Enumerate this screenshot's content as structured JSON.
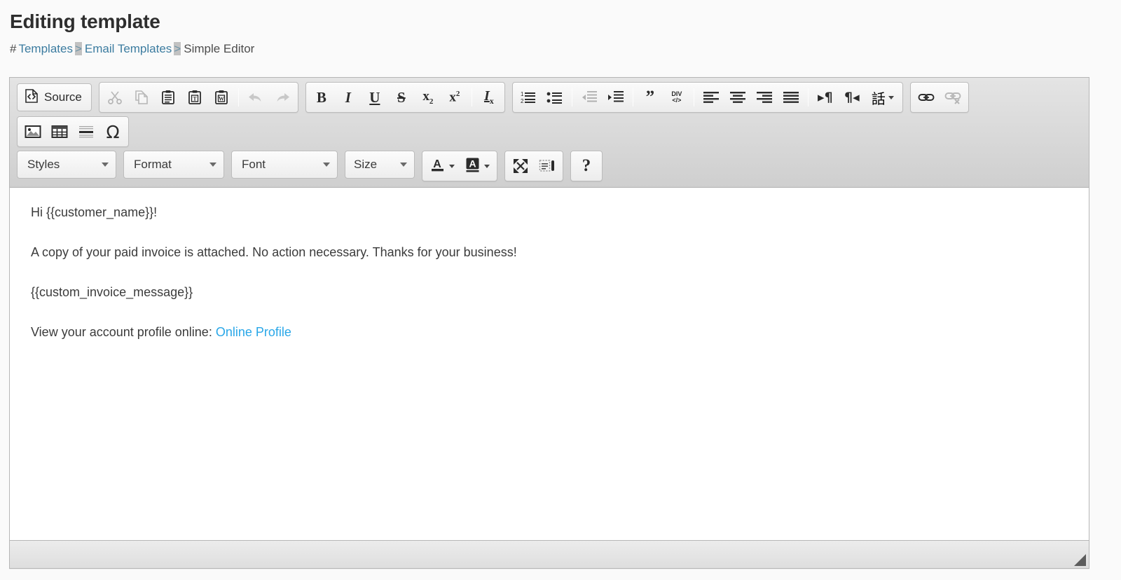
{
  "header": {
    "title": "Editing template",
    "breadcrumb": {
      "hash": "#",
      "items": [
        {
          "label": "Templates",
          "link": true
        },
        {
          "label": "Email Templates",
          "link": true
        },
        {
          "label": "Simple Editor",
          "link": false
        }
      ],
      "separator": ">"
    }
  },
  "editor": {
    "toolbar": {
      "source_button": {
        "label": "Source",
        "icon": "source-code-icon",
        "enabled": true
      },
      "clipboard": [
        {
          "name": "cut",
          "icon": "scissors-icon",
          "enabled": false
        },
        {
          "name": "copy",
          "icon": "copy-icon",
          "enabled": false
        },
        {
          "name": "paste",
          "icon": "paste-icon",
          "enabled": true
        },
        {
          "name": "paste-as-plain-text",
          "icon": "paste-text-icon",
          "enabled": true
        },
        {
          "name": "paste-from-word",
          "icon": "paste-word-icon",
          "enabled": true
        }
      ],
      "history": [
        {
          "name": "undo",
          "icon": "undo-arrow-icon",
          "enabled": false
        },
        {
          "name": "redo",
          "icon": "redo-arrow-icon",
          "enabled": false
        }
      ],
      "basic_styles": [
        {
          "name": "bold",
          "icon": "bold-icon",
          "glyph": "B",
          "enabled": true
        },
        {
          "name": "italic",
          "icon": "italic-icon",
          "glyph": "I",
          "enabled": true
        },
        {
          "name": "underline",
          "icon": "underline-icon",
          "glyph": "U",
          "enabled": true
        },
        {
          "name": "strikethrough",
          "icon": "strikethrough-icon",
          "glyph": "S",
          "enabled": true
        },
        {
          "name": "subscript",
          "icon": "subscript-icon",
          "glyph": "x",
          "sub": "2",
          "enabled": true
        },
        {
          "name": "superscript",
          "icon": "superscript-icon",
          "glyph": "x",
          "sup": "2",
          "enabled": true
        },
        {
          "name": "remove-format",
          "icon": "remove-format-icon",
          "glyph": "I",
          "sub": "x",
          "enabled": true
        }
      ],
      "paragraph": [
        {
          "name": "numbered-list",
          "icon": "numbered-list-icon",
          "enabled": true
        },
        {
          "name": "bulleted-list",
          "icon": "bulleted-list-icon",
          "enabled": true
        },
        {
          "name": "decrease-indent",
          "icon": "outdent-icon",
          "enabled": false
        },
        {
          "name": "increase-indent",
          "icon": "indent-icon",
          "enabled": true
        },
        {
          "name": "blockquote",
          "icon": "blockquote-icon",
          "glyph": "”",
          "enabled": true
        },
        {
          "name": "create-div",
          "icon": "create-div-icon",
          "line1": "DIV",
          "line2": "</>",
          "enabled": true
        },
        {
          "name": "align-left",
          "icon": "align-left-icon",
          "enabled": true
        },
        {
          "name": "align-center",
          "icon": "align-center-icon",
          "enabled": true
        },
        {
          "name": "align-right",
          "icon": "align-right-icon",
          "enabled": true
        },
        {
          "name": "justify",
          "icon": "justify-icon",
          "enabled": true
        },
        {
          "name": "text-direction-ltr",
          "icon": "ltr-icon",
          "glyph": "▸¶",
          "enabled": true
        },
        {
          "name": "text-direction-rtl",
          "icon": "rtl-icon",
          "glyph": "¶◂",
          "enabled": true
        },
        {
          "name": "language",
          "icon": "language-icon",
          "glyph": "話",
          "enabled": true
        }
      ],
      "links": [
        {
          "name": "link",
          "icon": "link-icon",
          "enabled": true
        },
        {
          "name": "unlink",
          "icon": "unlink-icon",
          "enabled": false
        }
      ],
      "insert": [
        {
          "name": "image",
          "icon": "image-icon",
          "enabled": true
        },
        {
          "name": "table",
          "icon": "table-icon",
          "enabled": true
        },
        {
          "name": "horizontal-rule",
          "icon": "horizontal-rule-icon",
          "enabled": true
        },
        {
          "name": "special-character",
          "icon": "omega-icon",
          "glyph": "Ω",
          "enabled": true
        }
      ],
      "combos": [
        {
          "name": "styles",
          "label": "Styles"
        },
        {
          "name": "format",
          "label": "Format"
        },
        {
          "name": "font",
          "label": "Font"
        },
        {
          "name": "size",
          "label": "Size"
        }
      ],
      "colors": [
        {
          "name": "text-color",
          "icon": "text-color-icon",
          "glyph": "A"
        },
        {
          "name": "background-color",
          "icon": "background-color-icon",
          "glyph": "A"
        }
      ],
      "tools": [
        {
          "name": "maximize",
          "icon": "maximize-icon",
          "enabled": true
        },
        {
          "name": "show-blocks",
          "icon": "show-blocks-icon",
          "enabled": true
        },
        {
          "name": "about",
          "icon": "help-icon",
          "glyph": "?",
          "enabled": true
        }
      ]
    },
    "content": {
      "paragraphs": [
        {
          "text": "Hi {{customer_name}}!"
        },
        {
          "text": "A copy of your paid invoice is attached. No action necessary. Thanks for your business!"
        },
        {
          "text": "{{custom_invoice_message}}"
        }
      ],
      "last_paragraph": {
        "prefix": "View your account profile online: ",
        "link_text": "Online Profile"
      }
    },
    "footer": {
      "resize_handle": "resize-grip"
    }
  },
  "colors": {
    "link": "#3c7ca0",
    "content_link": "#29a7e8",
    "toolbar_bg": "#d5d5d5",
    "text": "#3b3b3b"
  }
}
